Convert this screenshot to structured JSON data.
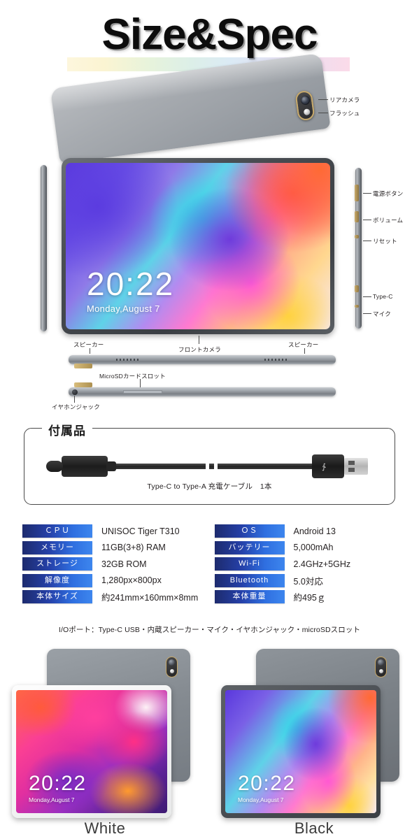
{
  "title": "Size&Spec",
  "device": {
    "screen_time": "20:22",
    "screen_date": "Monday,August 7",
    "callouts": {
      "rear_camera": "リアカメラ",
      "flash": "フラッシュ",
      "power_button": "電源ボタン",
      "volume": "ボリューム",
      "reset": "リセット",
      "type_c": "Type-C",
      "mic": "マイク",
      "front_camera": "フロントカメラ",
      "speaker_left": "スピーカー",
      "speaker_right": "スピーカー",
      "microsd_slot": "MicroSDカードスロット",
      "earphone_jack": "イヤホンジャック"
    }
  },
  "accessories": {
    "heading": "付属品",
    "cable_label": "Type-C to Type-A 充電ケーブル　1本"
  },
  "spec": {
    "left": [
      {
        "key": "ＣＰＵ",
        "value": "UNISOC Tiger T310"
      },
      {
        "key": "メモリー",
        "value": "11GB(3+8) RAM"
      },
      {
        "key": "ストレージ",
        "value": "32GB ROM"
      },
      {
        "key": "解像度",
        "value": "1,280px×800px"
      },
      {
        "key": "本体サイズ",
        "value": "約241mm×160mm×8mm"
      }
    ],
    "right": [
      {
        "key": "ＯＳ",
        "value": "Android 13"
      },
      {
        "key": "バッテリー",
        "value": "5,000mAh"
      },
      {
        "key": "Wi-Fi",
        "value": "2.4GHz+5GHz"
      },
      {
        "key": "Bluetooth",
        "value": "5.0対応"
      },
      {
        "key": "本体重量",
        "value": "約495ｇ"
      }
    ],
    "io_line": "I/Oポート：Type-C USB・内蔵スピーカー・マイク・イヤホンジャック・microSDスロット"
  },
  "variants": [
    {
      "name": "White",
      "time": "20:22",
      "date": "Monday,August 7"
    },
    {
      "name": "Black",
      "time": "20:22",
      "date": "Monday,August 7"
    }
  ],
  "colors": {
    "badge_gradient_start": "#1d2b6e",
    "badge_gradient_end": "#3d86ee",
    "text": "#231f20",
    "background": "#ffffff"
  }
}
